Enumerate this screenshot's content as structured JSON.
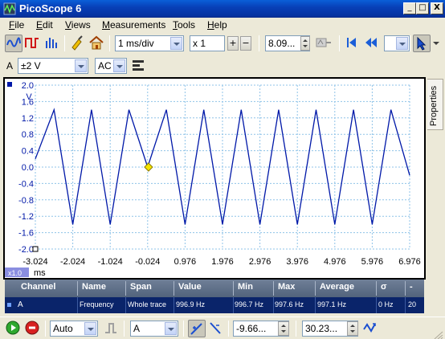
{
  "window": {
    "title": "PicoScope 6",
    "buttons": [
      "_",
      "□",
      "X"
    ]
  },
  "menu": {
    "items": [
      {
        "label": "File",
        "u": "F",
        "rest": "ile"
      },
      {
        "label": "Edit",
        "u": "E",
        "rest": "dit"
      },
      {
        "label": "Views",
        "u": "V",
        "rest": "iews"
      },
      {
        "label": "Measurements",
        "u": "M",
        "rest": "easurements"
      },
      {
        "label": "Tools",
        "u": "T",
        "rest": "ools"
      },
      {
        "label": "Help",
        "u": "H",
        "rest": "elp"
      }
    ]
  },
  "toolbar": {
    "timebase": "1 ms/div",
    "zoom": "x 1",
    "samples": "8.09...",
    "plus": "+",
    "minus": "−"
  },
  "channel_bar": {
    "channel": "A",
    "range": "±2 V",
    "coupling": "AC"
  },
  "scope": {
    "y_unit": "V",
    "y_ticks": [
      "2.0",
      "1.6",
      "1.2",
      "0.8",
      "0.4",
      "0.0",
      "-0.4",
      "-0.8",
      "-1.2",
      "-1.6",
      "-2.0"
    ],
    "x_ticks": [
      "-3.024",
      "-2.024",
      "-1.024",
      "-0.024",
      "0.976",
      "1.976",
      "2.976",
      "3.976",
      "4.976",
      "5.976",
      "6.976"
    ],
    "x_unit": "ms",
    "zoom_badge": "x1.0",
    "trace_color": "#0018a8",
    "trigger_color": "#f5e400"
  },
  "chart_data": {
    "type": "line",
    "series": [
      {
        "x": [
          -3.024,
          -2.524,
          -2.024,
          -1.524,
          -1.024,
          -0.524,
          -0.024,
          0.476,
          0.976,
          1.476,
          1.976,
          2.476,
          2.976,
          3.476,
          3.976,
          4.476,
          4.976,
          5.476,
          5.976,
          6.476,
          6.976
        ],
        "y": [
          0.2,
          1.4,
          -1.4,
          1.4,
          -1.4,
          1.4,
          0,
          1.4,
          -1.4,
          1.4,
          -1.4,
          1.4,
          -1.4,
          1.4,
          -1.4,
          1.4,
          -1.4,
          1.4,
          -1.4,
          1.4,
          -0.2
        ]
      }
    ],
    "xlim": [
      -3.024,
      6.976
    ],
    "ylim": [
      -2.0,
      2.0
    ],
    "xlabel": "ms",
    "ylabel": "V",
    "grid": true
  },
  "properties_tab": "Properties",
  "measurements": {
    "headers": [
      "Channel",
      "Name",
      "Span",
      "Value",
      "Min",
      "Max",
      "Average",
      "σ",
      "-"
    ],
    "rows": [
      [
        "A",
        "Frequency",
        "Whole trace",
        "996.9 Hz",
        "996.7 Hz",
        "997.6 Hz",
        "997.1 Hz",
        "0 Hz",
        "20"
      ]
    ]
  },
  "bottombar": {
    "trigger_mode": "Auto",
    "trigger_source": "A",
    "threshold": "-9.66...",
    "pretrigger": "30.23..."
  }
}
